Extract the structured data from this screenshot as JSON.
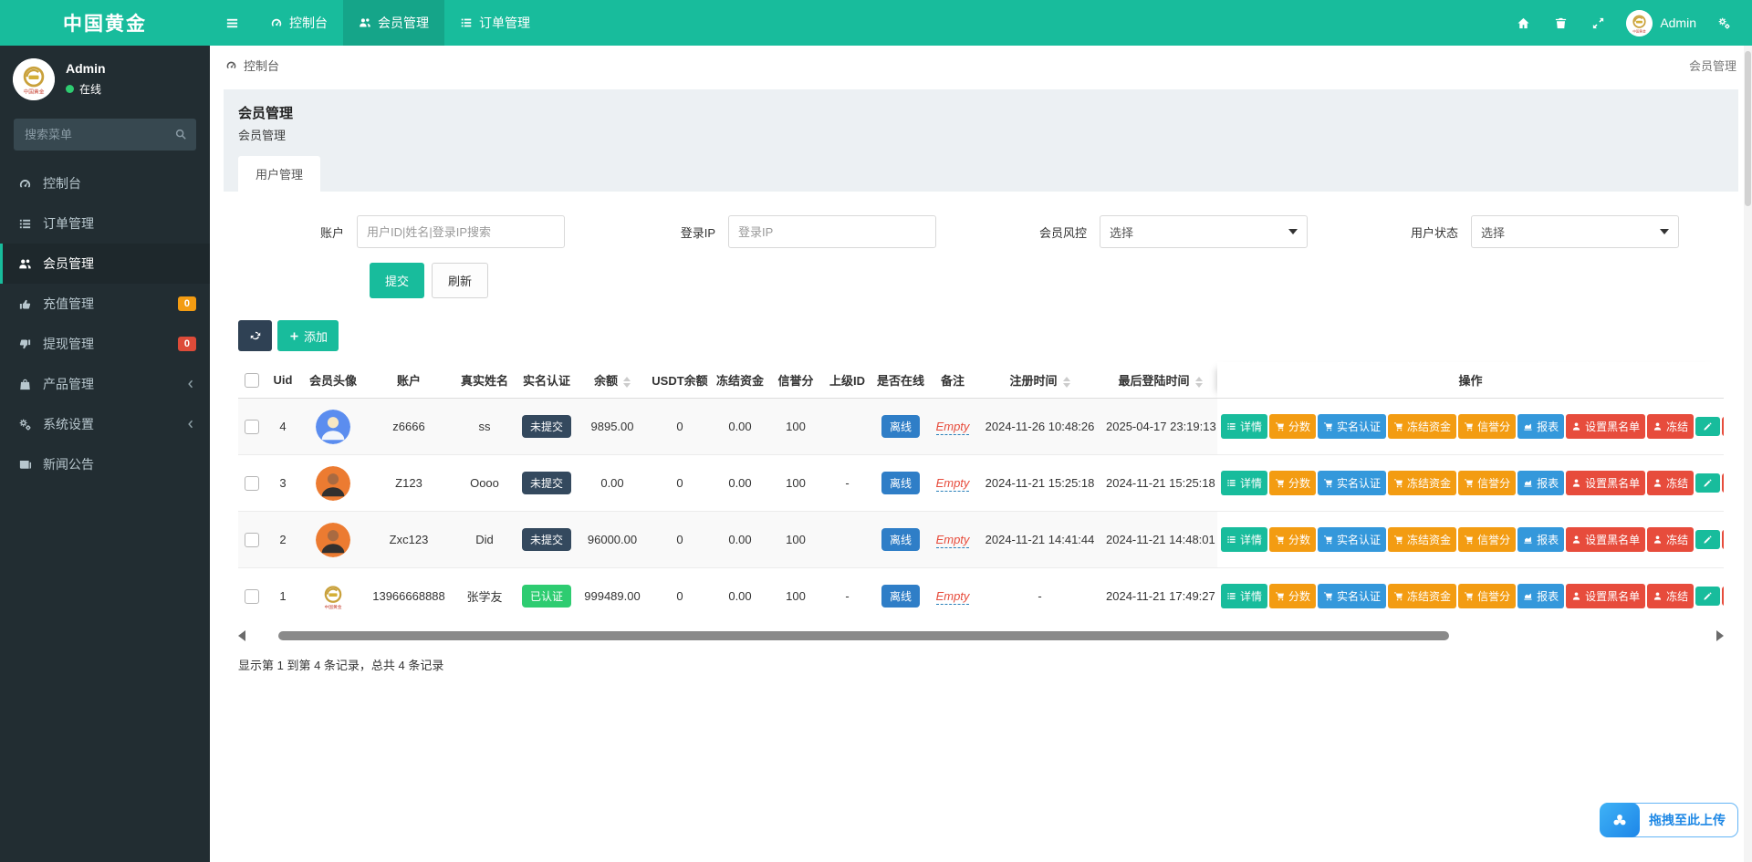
{
  "brand": {
    "logo": "中国黄金"
  },
  "navbar": {
    "items": [
      {
        "label": "控制台",
        "icon": "gauge",
        "active": false
      },
      {
        "label": "会员管理",
        "icon": "users",
        "active": true
      },
      {
        "label": "订单管理",
        "icon": "list",
        "active": false
      }
    ],
    "user": "Admin"
  },
  "sidebar": {
    "user": {
      "name": "Admin",
      "status": "在线"
    },
    "search_placeholder": "搜索菜单",
    "items": [
      {
        "label": "控制台",
        "icon": "gauge"
      },
      {
        "label": "订单管理",
        "icon": "list"
      },
      {
        "label": "会员管理",
        "icon": "users",
        "active": true
      },
      {
        "label": "充值管理",
        "icon": "thumbup",
        "badge": "0",
        "badge_color": "#f39c12"
      },
      {
        "label": "提现管理",
        "icon": "thumbdown",
        "badge": "0",
        "badge_color": "#dd4b39"
      },
      {
        "label": "产品管理",
        "icon": "bag",
        "chevron": true
      },
      {
        "label": "系统设置",
        "icon": "gears",
        "chevron": true
      },
      {
        "label": "新闻公告",
        "icon": "news"
      }
    ]
  },
  "breadcrumb": {
    "location": "控制台",
    "page": "会员管理"
  },
  "panel": {
    "title": "会员管理",
    "subtitle": "会员管理",
    "tab": "用户管理",
    "filters": {
      "account_label": "账户",
      "account_placeholder": "用户ID|姓名|登录IP搜索",
      "ip_label": "登录IP",
      "ip_placeholder": "登录IP",
      "risk_label": "会员风控",
      "risk_value": "选择",
      "status_label": "用户状态",
      "status_value": "选择",
      "submit_label": "提交",
      "refresh_label": "刷新"
    },
    "toolbar": {
      "add_label": "添加"
    },
    "table": {
      "columns": [
        {
          "label": "Uid"
        },
        {
          "label": "会员头像"
        },
        {
          "label": "账户"
        },
        {
          "label": "真实姓名"
        },
        {
          "label": "实名认证"
        },
        {
          "label": "余额",
          "sortable": true
        },
        {
          "label": "USDT余额"
        },
        {
          "label": "冻结资金"
        },
        {
          "label": "信誉分"
        },
        {
          "label": "上级ID"
        },
        {
          "label": "是否在线"
        },
        {
          "label": "备注"
        },
        {
          "label": "注册时间",
          "sortable": true
        },
        {
          "label": "最后登陆时间",
          "sortable": true
        },
        {
          "label": "操作",
          "action": true
        }
      ],
      "rows": [
        {
          "uid": "4",
          "avatar": "blue",
          "account": "z6666",
          "name": "ss",
          "verify": "未提交",
          "verify_state": "dark",
          "balance": "9895.00",
          "usdt": "0",
          "frozen": "0.00",
          "credit": "100",
          "parent": "",
          "online": "离线",
          "remark": "Empty",
          "reg": "2024-11-26 10:48:26",
          "last": "2025-04-17 23:19:13"
        },
        {
          "uid": "3",
          "avatar": "orange",
          "account": "Z123",
          "name": "Oooo",
          "verify": "未提交",
          "verify_state": "dark",
          "balance": "0.00",
          "usdt": "0",
          "frozen": "0.00",
          "credit": "100",
          "parent": "-",
          "online": "离线",
          "remark": "Empty",
          "reg": "2024-11-21 15:25:18",
          "last": "2024-11-21 15:25:18"
        },
        {
          "uid": "2",
          "avatar": "orange",
          "account": "Zxc123",
          "name": "Did",
          "verify": "未提交",
          "verify_state": "dark",
          "balance": "96000.00",
          "usdt": "0",
          "frozen": "0.00",
          "credit": "100",
          "parent": "",
          "online": "离线",
          "remark": "Empty",
          "reg": "2024-11-21 14:41:44",
          "last": "2024-11-21 14:48:01"
        },
        {
          "uid": "1",
          "avatar": "gold",
          "account": "13966668888",
          "name": "张学友",
          "verify": "已认证",
          "verify_state": "green",
          "balance": "999489.00",
          "usdt": "0",
          "frozen": "0.00",
          "credit": "100",
          "parent": "-",
          "online": "离线",
          "remark": "Empty",
          "reg": "-",
          "last": "2024-11-21 17:49:27"
        }
      ],
      "actions": [
        {
          "label": "详情",
          "name": "detail",
          "color": "green",
          "icon": "list"
        },
        {
          "label": "分数",
          "name": "score",
          "color": "orange",
          "icon": "cart"
        },
        {
          "label": "实名认证",
          "name": "realname",
          "color": "blue",
          "icon": "cart"
        },
        {
          "label": "冻结资金",
          "name": "freeze-funds",
          "color": "orange",
          "icon": "cart"
        },
        {
          "label": "信誉分",
          "name": "credit-score",
          "color": "orange",
          "icon": "cart"
        },
        {
          "label": "报表",
          "name": "report",
          "color": "blue",
          "icon": "chart"
        },
        {
          "label": "设置黑名单",
          "name": "blacklist",
          "color": "red",
          "icon": "person"
        },
        {
          "label": "冻结",
          "name": "freeze",
          "color": "red",
          "icon": "person"
        }
      ],
      "footer": "显示第 1 到第 4 条记录，总共 4 条记录"
    }
  },
  "upload": {
    "label": "拖拽至此上传"
  },
  "colors": {
    "accent": "#18bc9c",
    "orange": "#f39c12",
    "blue": "#3498db",
    "red": "#e74c3c",
    "sidebar": "#222d32",
    "badge_dark": "#34495e",
    "badge_green": "#2ecc71",
    "badge_blue": "#2f7ec7"
  }
}
